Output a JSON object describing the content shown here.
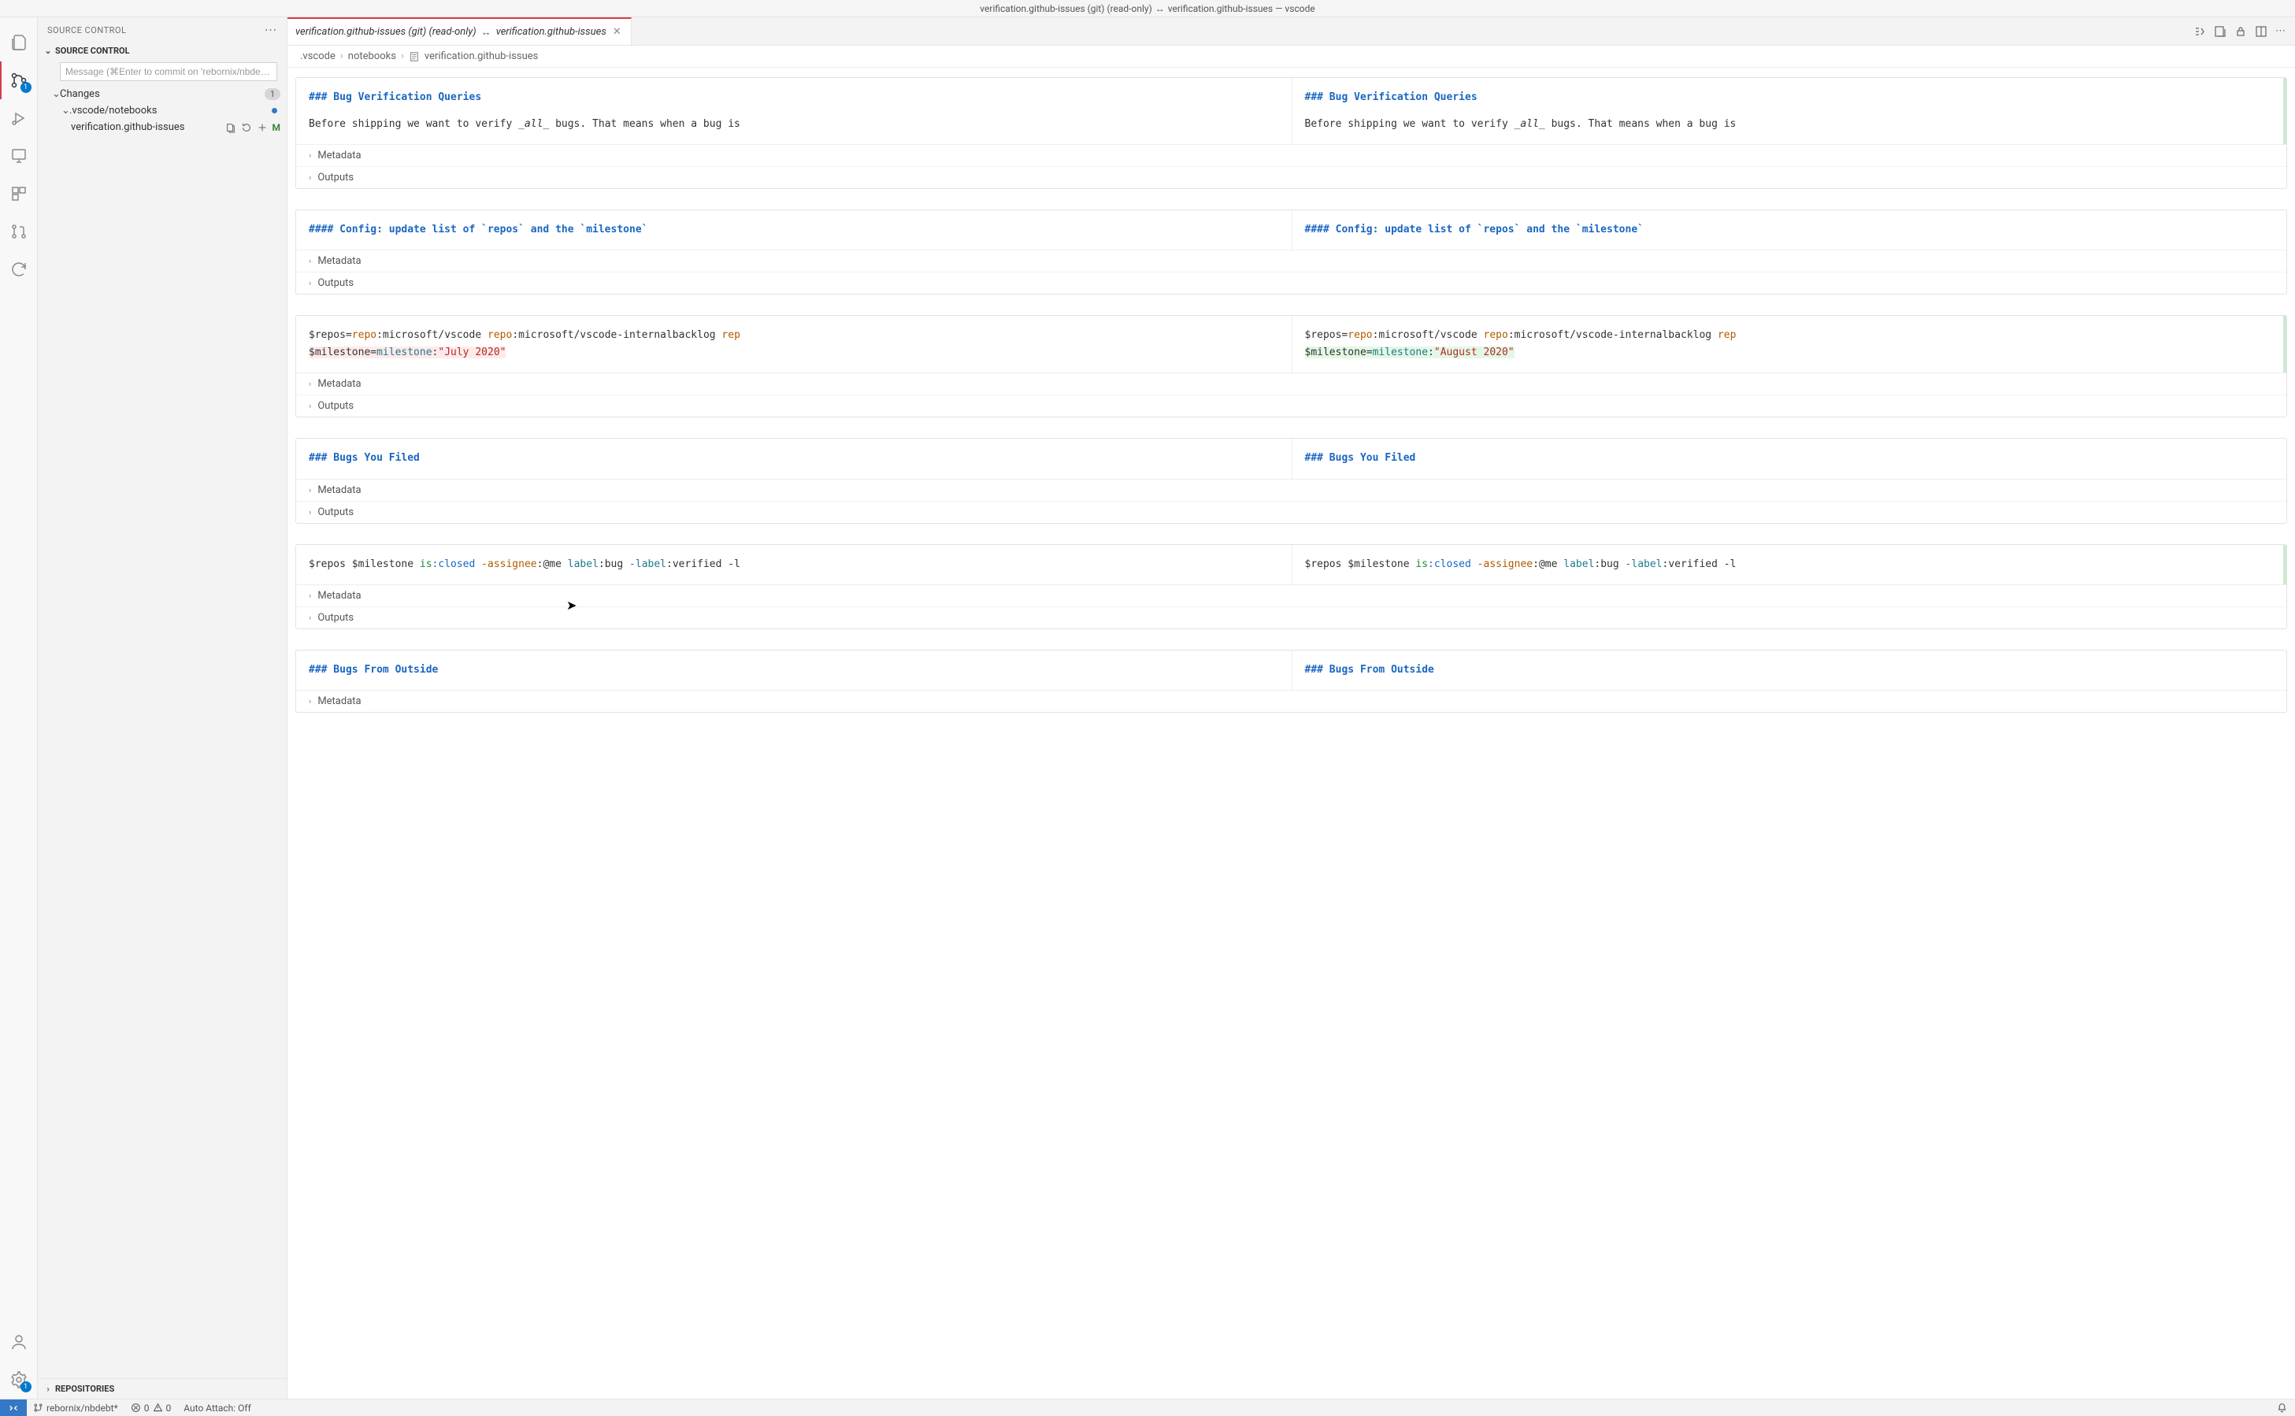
{
  "titlebar": {
    "left": "verification.github-issues (git) (read-only)",
    "arrows": "↔",
    "right": "verification.github-issues — vscode"
  },
  "activitybar": {
    "scm_badge": "1",
    "settings_badge": "1"
  },
  "sidebar": {
    "title": "SOURCE CONTROL",
    "section": "SOURCE CONTROL",
    "commit_placeholder": "Message (⌘Enter to commit on 'rebornix/nbde…",
    "changes_label": "Changes",
    "changes_count": "1",
    "folder": ".vscode/notebooks",
    "file": "verification.github-issues",
    "file_status": "M",
    "repos": "REPOSITORIES"
  },
  "tab": {
    "left": "verification.github-issues (git) (read-only)",
    "arrows": "↔",
    "right": "verification.github-issues"
  },
  "breadcrumbs": {
    "seg1": ".vscode",
    "seg2": "notebooks",
    "seg3": "verification.github-issues"
  },
  "metaLabels": {
    "metadata": "Metadata",
    "outputs": "Outputs"
  },
  "cells": [
    {
      "h3_left": "### Bug Verification Queries",
      "h3_right": "### Bug Verification Queries",
      "body_prefix": "Before shipping we want to verify ",
      "body_em": "_all_",
      "body_suffix": " bugs. That means when a bug is"
    },
    {
      "h4_left": "#### Config: update list of `repos` and the `milestone`",
      "h4_right": "#### Config: update list of `repos` and the `milestone`"
    },
    {
      "code": {
        "line1_pre": "$repos=",
        "line1_repo": "repo",
        "line1_c1": ":microsoft/vscode ",
        "line1_repo2": "repo",
        "line1_c2": ":microsoft/vscode-internalbacklog ",
        "line1_repo3": "rep",
        "line2_pre": "$milestone=",
        "line2_attr": "milestone",
        "line2_colon": ":",
        "line2_left_val": "\"July 2020\"",
        "line2_right_val": "\"August 2020\""
      }
    },
    {
      "h3_left": "### Bugs You Filed",
      "h3_right": "### Bugs You Filed"
    },
    {
      "code2": {
        "pre": "$repos $milestone ",
        "is": "is",
        "closed": ":closed ",
        "dashassignee": "-assignee",
        "me": ":@me ",
        "label": "label",
        "bug": ":bug ",
        "dashlabel": "-label",
        "verified": ":verified ",
        "dashl": "-l"
      }
    },
    {
      "h3_left": "### Bugs From Outside",
      "h3_right": "### Bugs From Outside"
    }
  ],
  "statusbar": {
    "branch": "rebornix/nbdebt*",
    "errors": "0",
    "warnings": "0",
    "auto_attach": "Auto Attach: Off"
  }
}
